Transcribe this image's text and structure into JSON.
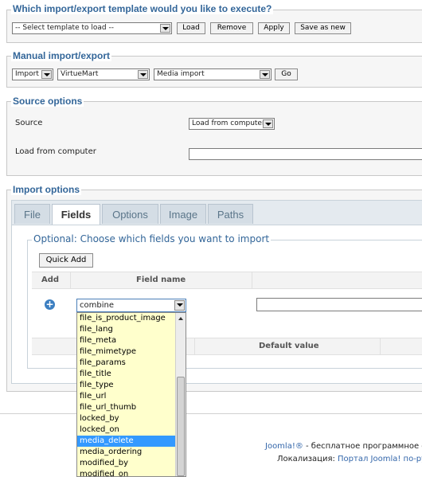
{
  "template": {
    "legend": "Which import/export template would you like to execute?",
    "select_value": "-- Select template to load --",
    "load": "Load",
    "remove": "Remove",
    "apply": "Apply",
    "save_as_new": "Save as new"
  },
  "manual": {
    "legend": "Manual import/export",
    "mode": "Import",
    "component": "VirtueMart",
    "operation": "Media import",
    "go": "Go"
  },
  "source": {
    "legend": "Source options",
    "source_label": "Source",
    "source_value": "Load from computer",
    "load_label": "Load from computer"
  },
  "import": {
    "legend": "Import options",
    "tabs": [
      "File",
      "Fields",
      "Options",
      "Image",
      "Paths"
    ],
    "optional_legend": "Optional: Choose which fields you want to import",
    "quick_add": "Quick Add",
    "col_add": "Add",
    "col_field_name": "Field name",
    "field_select_value": "combine",
    "col_default_value": "Default value"
  },
  "dropdown": {
    "items": [
      "file_is_product_image",
      "file_lang",
      "file_meta",
      "file_mimetype",
      "file_params",
      "file_title",
      "file_type",
      "file_url",
      "file_url_thumb",
      "locked_by",
      "locked_on",
      "media_delete",
      "media_ordering",
      "modified_by",
      "modified_on"
    ],
    "selected": "media_delete"
  },
  "footer": {
    "line1_link": "Joomla!®",
    "line1_text": " - бесплатное программное об",
    "line2_label": "Локализация: ",
    "line2_link": "Портал Joomla! по-русс"
  }
}
